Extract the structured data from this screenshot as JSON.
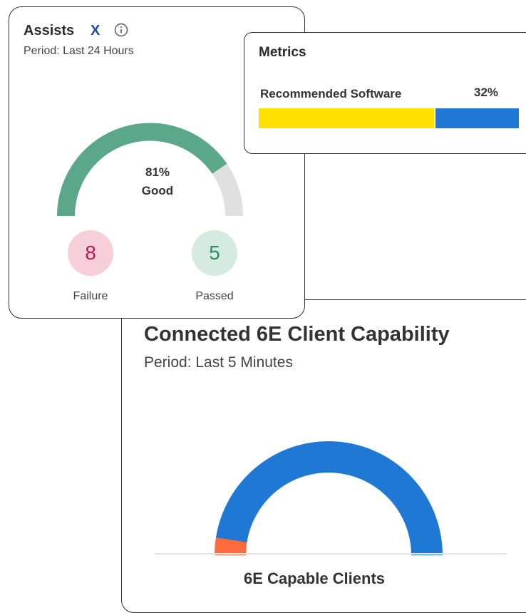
{
  "assists": {
    "title": "Assists",
    "logo": "X",
    "info_icon": "info-circle-icon",
    "period": "Period: Last 24 Hours",
    "gauge": {
      "percent": 81,
      "value_text": "81%",
      "status_text": "Good",
      "fill_color": "#5aa889",
      "track_color": "#e0e0e0"
    },
    "failure": {
      "count": "8",
      "label": "Failure",
      "color": "#c2184b",
      "bg": "#f6cfd9"
    },
    "passed": {
      "count": "5",
      "label": "Passed",
      "color": "#2e8a68",
      "bg": "#d5ebe2"
    }
  },
  "metrics": {
    "title": "Metrics",
    "item": {
      "label": "Recommended Software",
      "value_text": "32%",
      "fill_fraction": 0.68,
      "fill_color": "#ffe000",
      "rest_color": "#1e78d4"
    }
  },
  "capability": {
    "title": "Connected 6E Client Capability",
    "period": "Period: Last 5 Minutes",
    "gauge": {
      "capable_fraction": 0.95,
      "capable_color": "#1e78d4",
      "other_color": "#ff6b3d"
    },
    "label": "6E Capable Clients"
  }
}
